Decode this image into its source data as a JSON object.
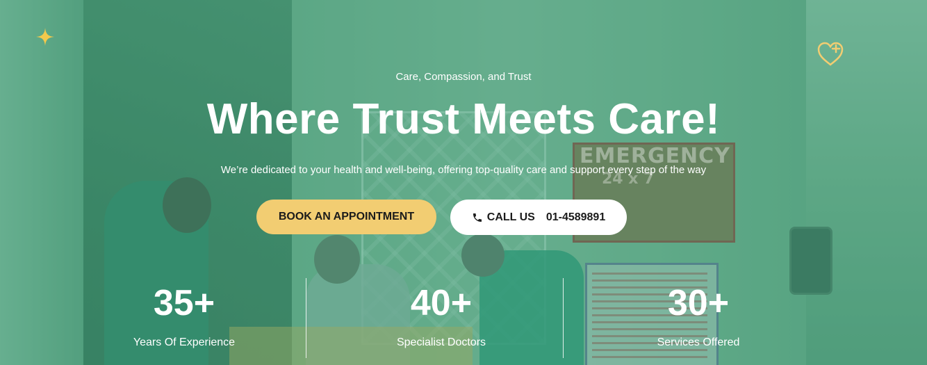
{
  "hero": {
    "tagline": "Care, Compassion, and Trust",
    "headline": "Where Trust Meets Care!",
    "subtext": "We’re dedicated to your health and well-being, offering top-quality care and support every step of the way"
  },
  "buttons": {
    "book_label": "BOOK AN APPOINTMENT",
    "call_label": "CALL US",
    "call_number": "01-4589891"
  },
  "stats": [
    {
      "value": "35+",
      "label": "Years Of Experience"
    },
    {
      "value": "40+",
      "label": "Specialist Doctors"
    },
    {
      "value": "30+",
      "label": "Services Offered"
    }
  ],
  "background": {
    "sign_main": "EMERGENCY",
    "sign_sub": "24 x 7"
  },
  "icons": {
    "sparkle": "sparkle-icon",
    "heart": "heart-plus-icon",
    "phone": "phone-icon"
  },
  "colors": {
    "accent": "#f2cd72",
    "overlay": "#3c9673",
    "text": "#ffffff"
  }
}
